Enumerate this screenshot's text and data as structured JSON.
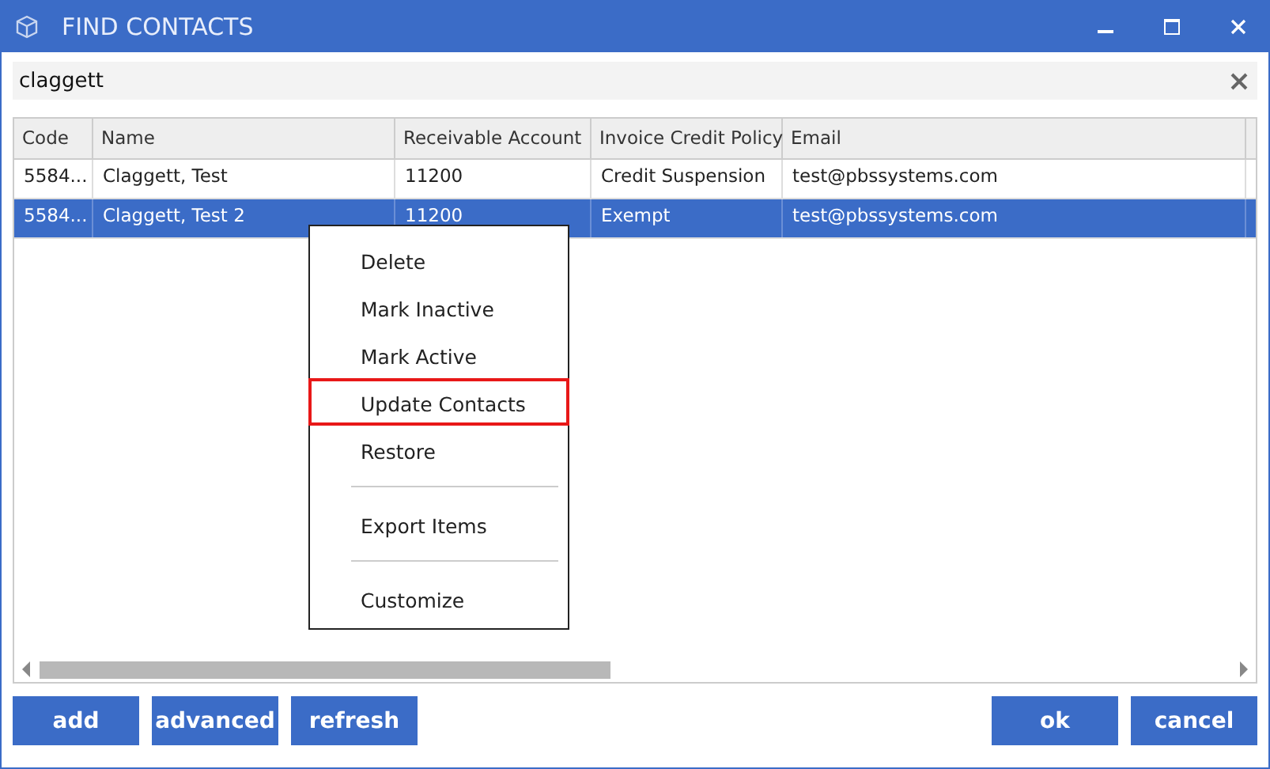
{
  "window": {
    "title": "FIND CONTACTS"
  },
  "search": {
    "value": "claggett"
  },
  "table": {
    "columns": [
      "Code",
      "Name",
      "Receivable Account",
      "Invoice Credit Policy",
      "Email"
    ],
    "rows": [
      {
        "selected": false,
        "cells": [
          "5584...",
          "Claggett, Test",
          "11200",
          "Credit Suspension",
          "test@pbssystems.com"
        ]
      },
      {
        "selected": true,
        "cells": [
          "5584...",
          "Claggett, Test 2",
          "11200",
          "Exempt",
          "test@pbssystems.com"
        ]
      }
    ]
  },
  "context_menu": {
    "items": [
      {
        "kind": "item",
        "label": "Delete",
        "highlighted": false
      },
      {
        "kind": "item",
        "label": "Mark Inactive",
        "highlighted": false
      },
      {
        "kind": "item",
        "label": "Mark Active",
        "highlighted": false
      },
      {
        "kind": "item",
        "label": "Update Contacts",
        "highlighted": true
      },
      {
        "kind": "item",
        "label": "Restore",
        "highlighted": false
      },
      {
        "kind": "separator"
      },
      {
        "kind": "item",
        "label": "Export Items",
        "highlighted": false
      },
      {
        "kind": "separator"
      },
      {
        "kind": "item",
        "label": "Customize",
        "highlighted": false
      }
    ]
  },
  "buttons_left": [
    "add",
    "advanced",
    "refresh"
  ],
  "buttons_right": [
    "ok",
    "cancel"
  ]
}
